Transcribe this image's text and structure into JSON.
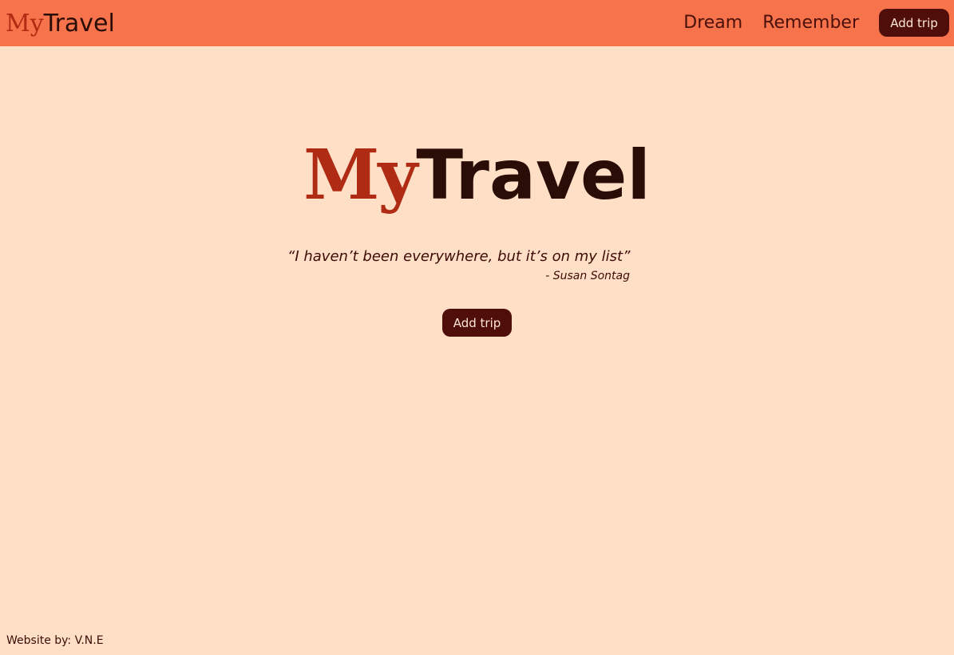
{
  "navbar": {
    "brand": {
      "part1": "My",
      "part2": "Travel"
    },
    "links": [
      "Dream",
      "Remember"
    ],
    "add_trip_label": "Add trip"
  },
  "hero": {
    "title_part1": "My",
    "title_part2": "Travel",
    "quote": "“I haven’t been everywhere, but it’s on my list”",
    "author": "- Susan Sontag",
    "add_trip_label": "Add trip"
  },
  "footer": {
    "text": "Website by: V.N.E"
  },
  "colors": {
    "navbar_bg": "#f6734b",
    "page_bg": "#ffdfc6",
    "brand_accent": "#b02b14",
    "button_bg": "#4f0e09",
    "text_dark": "#2a0d06"
  }
}
